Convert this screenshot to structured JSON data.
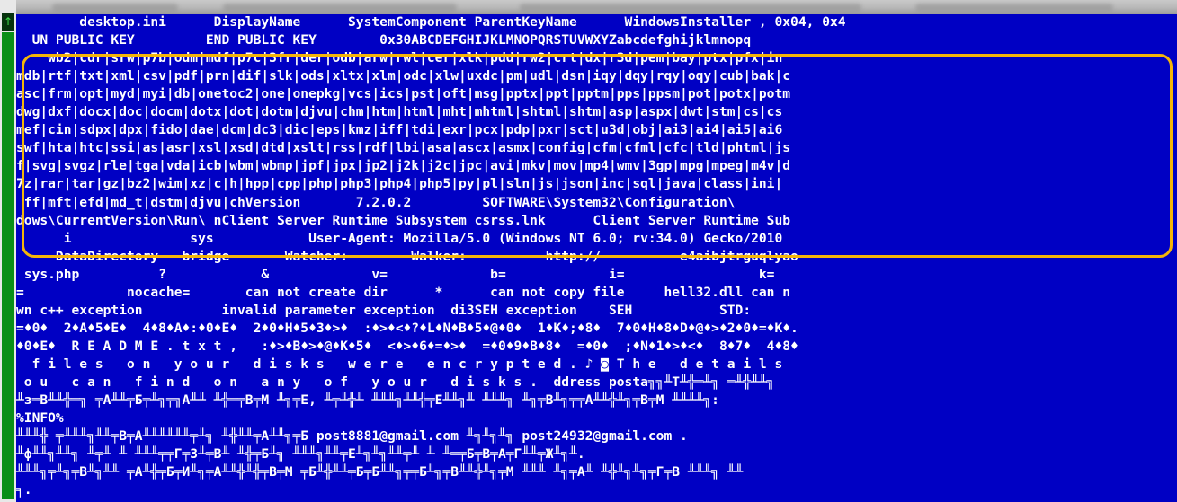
{
  "scrollbar": {
    "up_glyph": "↑"
  },
  "hex_view": {
    "lines": [
      "        desktop.ini      DisplayName      SystemComponent ParentKeyName      WindowsInstaller , 0x04, 0x4",
      "  UN PUBLIC KEY         END PUBLIC KEY        0x30ABCDEFGHIJKLMNOPQRSTUVWXYZabcdefghijklmnopq",
      "    wb2|cdr|srw|p7b|odm|mdf|p7c|3fr|der|odb|arw|rwl|cer|xlk|pdd|rw2|crt|dx|r3d|pem|bay|ptx|pfx|in",
      "mdb|rtf|txt|xml|csv|pdf|prn|dif|slk|ods|xltx|xlm|odc|xlw|uxdc|pm|udl|dsn|iqy|dqy|rqy|oqy|cub|bak|c",
      "asc|frm|opt|myd|myi|db|onetoc2|one|onepkg|vcs|ics|pst|oft|msg|pptx|ppt|pptm|pps|ppsm|pot|potx|potm",
      "dwg|dxf|docx|doc|docm|dotx|dot|dotm|djvu|chm|htm|html|mht|mhtml|shtml|shtm|asp|aspx|dwt|stm|cs|cs",
      "mef|cin|sdpx|dpx|fido|dae|dcm|dc3|dic|eps|kmz|iff|tdi|exr|pcx|pdp|pxr|sct|u3d|obj|ai3|ai4|ai5|ai6",
      "swf|hta|htc|ssi|as|asr|xsl|xsd|dtd|xslt|rss|rdf|lbi|asa|ascx|asmx|config|cfm|cfml|cfc|tld|phtml|js",
      "f|svg|svgz|rle|tga|vda|icb|wbm|wbmp|jpf|jpx|jp2|j2k|j2c|jpc|avi|mkv|mov|mp4|wmv|3gp|mpg|mpeg|m4v|d",
      "7z|rar|tar|gz|bz2|wim|xz|c|h|hpp|cpp|php|php3|php4|php5|py|pl|sln|js|json|inc|sql|java|class|ini|",
      " ff|mft|efd|md_t|dstm|djvu|chVersion       7.2.0.2         SOFTWARE\\System32\\Configuration\\",
      "dows\\CurrentVersion\\Run\\ nClient Server Runtime Subsystem csrss.lnk      Client Server Runtime Sub",
      "      i               sys            User-Agent: Mozilla/5.0 (Windows NT 6.0; rv:34.0) Gecko/2010",
      "   --DataDirectory --bridge       Watcher:        Walker:          http://          e4aibjtrguqlyao",
      " sys.php          ?            &             v=             b=             i=                 k=",
      "=             nocache=       can not create dir      *      can not copy file     hell32.dll can n",
      "wn c++ exception          invalid parameter exception  di3SEH exception    SEH           STD:",
      "=♦0♦  2♦A♦5♦E♦  4♦8♦A♦:♦0♦E♦  2♦0♦H♦5♦3♦>♦  :♦>♦<♦?♦L♦N♦B♦5♦@♦0♦  1♦K♦;♦8♦  7♦0♦H♦8♦D♦@♦>♦2♦0♦=♦K♦.",
      "♦0♦E♦  R E A D M E . t x t ,   :♦>♦B♦>♦@♦K♦5♦  <♦>♦6♦=♦>♦  =♦0♦9♦B♦8♦  =♦0♦  ;♦N♦1♦>♦<♦  8♦7♦  4♦8♦",
      "  f i l e s   o n   y o u r   d i s k s   w e r e   e n c r y p t e d . ♪ ◙ T h e   d e t a i l s",
      " o u   c a n   f i n d   o n   a n y   o f   y o u r   d i s k s .  ddress posta╗╗╨T╨╬═╨╗ ═╨╬╨╨╗",
      "╨з═В╨╨╬═╗ ╤А╨╨╤Б╤╨╗╤╗А╨╨ ╨╬═╤В╤М ╨╗╤Е, ╨╤╨╬╨ ╨╨╨╗╨╨╬╤Е╨╨╗╨ ╨╨╨╗ ╨╗╤В╨╗╤╤А╨╨╬╨╗╤В╤М ╨╨╨╨╗:",
      "%INFO%",
      "╨╨╨╬ ╤╨╨╨╗╨╨╤В╤А╨╨╨╨╨╨╤╨╗ ╨╬╨╨╤А╨╨╗╤Б post8881@gmail.com ╨╗╨╗╨╗ post24932@gmail.com .",
      "╨ф╨╨╗╨╨╗ ╨╤╨ ╨ ╨╨╨╤╤Г╤З╨╤В╨ ╨╬╤Б╨╗ ╨╨╨╗╨╨╤Е╨╗╨╗╨╨╤╨ ╨ ╨═╤Б╤В╤А╤Г╨╨╤Ж╨╗╨.",
      "╨╨╨╗╤╨╗╤В╨╗╨╨ ╤А╨╬╤Б╤И╨╗╤А╨╨╬╨╬╤В╤М ╤Б╨╬╨╨╤Б╤Б╨╨╗╤╤Б╨╗╤В╨╨╬╨╗╤М ╨╨╨ ╨╗╤А╨ ╨╬╨╗╨╗╤Г╤В ╨╨╨╗ ╨╨",
      "╕."
    ]
  },
  "colors": {
    "background": "#0000c4",
    "text": "#ffffff",
    "highlight_border": "#f4b50a",
    "scrollbar": "#0a8f18"
  }
}
